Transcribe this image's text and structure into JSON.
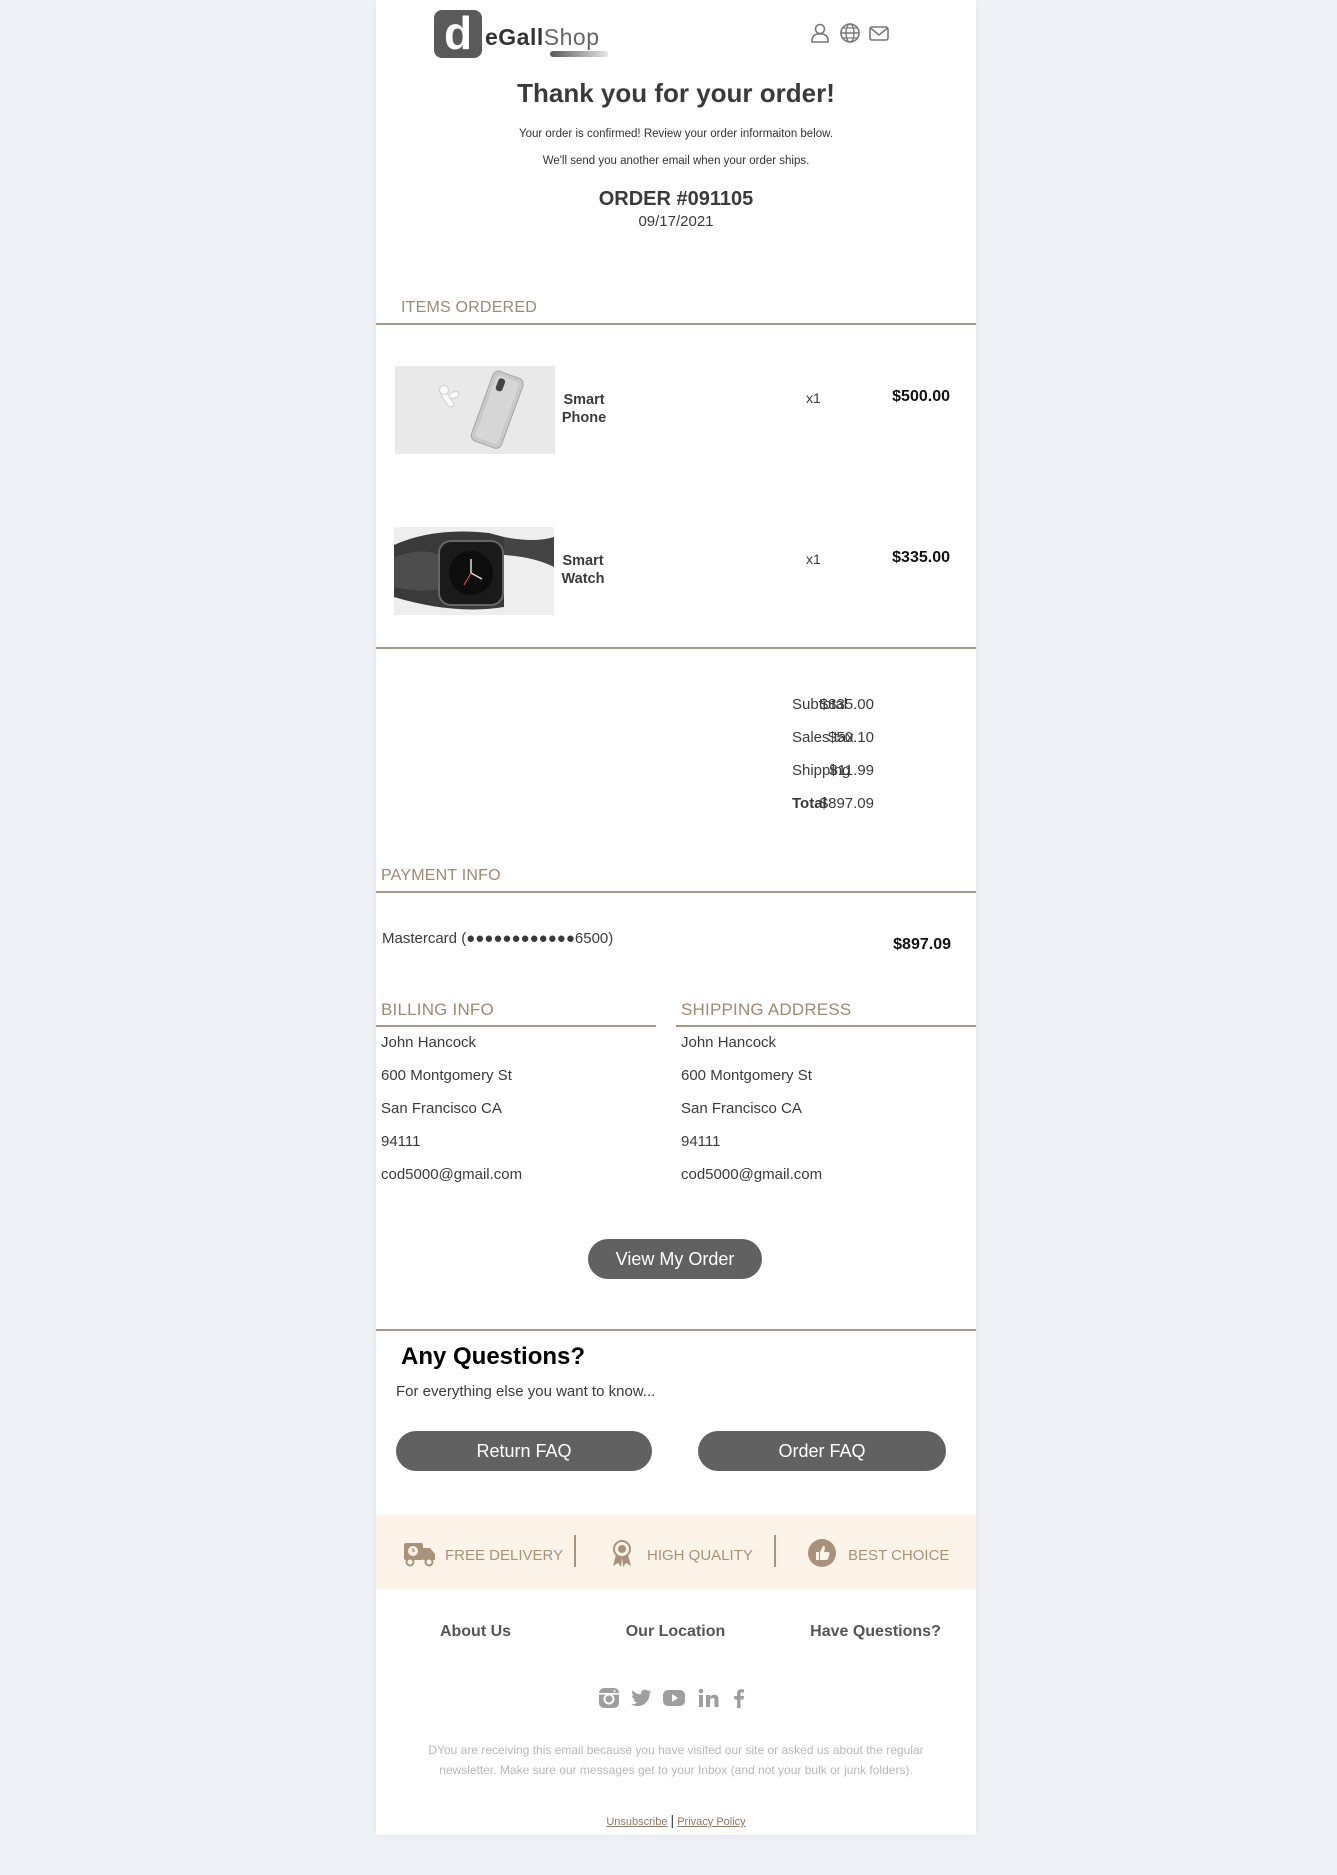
{
  "brand": {
    "logo_letter": "d",
    "name_bold": "eGall",
    "name_light": "Shop"
  },
  "header": {
    "title": "Thank you for your order!",
    "line1": "Your order is confirmed! Review your order informaiton below.",
    "line2": "We'll send you another email when your order ships.",
    "order_number": "ORDER #091105",
    "order_date": "09/17/2021"
  },
  "items_section": {
    "heading": "ITEMS ORDERED"
  },
  "items": [
    {
      "name": "Smart Phone",
      "qty": "x1",
      "price": "$500.00"
    },
    {
      "name": "Smart Watch",
      "qty": "x1",
      "price": "$335.00"
    }
  ],
  "summary": {
    "subtotal_label": "Subtotal",
    "subtotal": "$835.00",
    "tax_label": "Sales tax",
    "tax": "$50.10",
    "shipping_label": "Shipping",
    "shipping": "$11.99",
    "total_label": "Total",
    "total": "$897.09"
  },
  "payment": {
    "heading": "PAYMENT INFO",
    "method": "Mastercard (●●●●●●●●●●●●6500)",
    "amount": "$897.09"
  },
  "billing": {
    "heading": "BILLING INFO",
    "lines": [
      "John Hancock",
      "600 Montgomery St",
      "San Francisco CA",
      "94111",
      "cod5000@gmail.com"
    ]
  },
  "shipping_address": {
    "heading": "SHIPPING ADDRESS",
    "lines": [
      "John Hancock",
      "600 Montgomery St",
      "San Francisco CA",
      "94111",
      "cod5000@gmail.com"
    ]
  },
  "view_order_button": "View My Order",
  "questions": {
    "title": "Any Questions?",
    "subtitle": "For everything else you want to know...",
    "return_faq": "Return FAQ",
    "order_faq": "Order FAQ"
  },
  "features": [
    "FREE DELIVERY",
    "HIGH QUALITY",
    "BEST CHOICE"
  ],
  "footer_links": [
    "About Us",
    "Our Location",
    "Have Questions?"
  ],
  "social": [
    "instagram-icon",
    "twitter-icon",
    "youtube-icon",
    "linkedin-icon",
    "facebook-icon"
  ],
  "disclaimer": "DYou are receiving this email because you have visited our site or asked us about the regular newsletter. Make sure our messages get to your Inbox (and not your bulk or junk folders).",
  "legal": {
    "unsubscribe": "Unsubscribe",
    "separator": "|",
    "privacy": "Privacy Policy"
  },
  "colors": {
    "accent": "#9b8a74",
    "button": "#616161",
    "features_bg": "#fcf4e8",
    "page_bg": "#eef2f7"
  }
}
